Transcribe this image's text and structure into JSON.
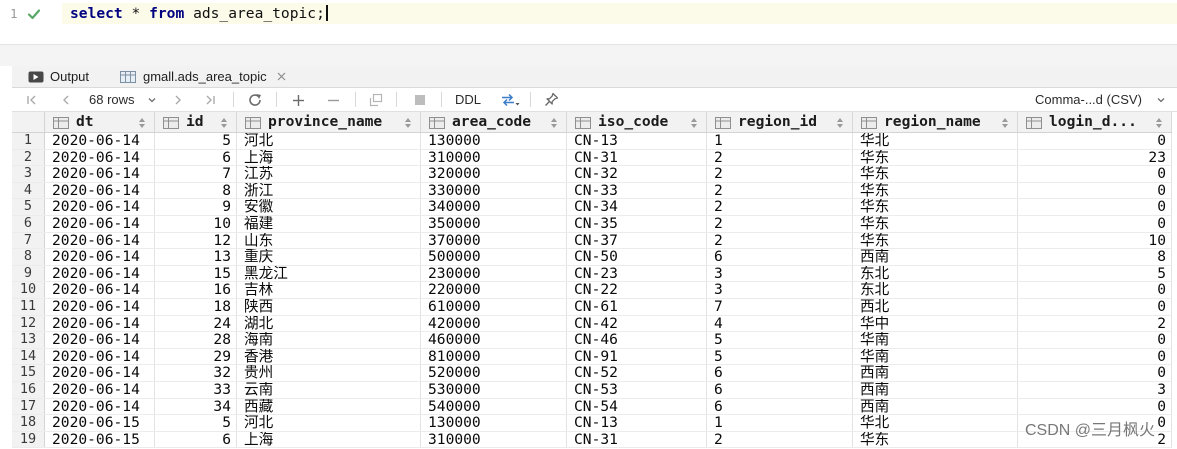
{
  "editor": {
    "line_number": "1",
    "status_icon": "check-icon",
    "tokens": {
      "kw_select": "select",
      "star": "*",
      "kw_from": "from",
      "table": "ads_area_topic",
      "semicolon": ";"
    }
  },
  "tabs": [
    {
      "label": "Output",
      "icon": "console-icon"
    },
    {
      "label": "gmall.ads_area_topic",
      "icon": "table-icon",
      "close_icon": "close-icon"
    }
  ],
  "toolbar": {
    "rows_label": "68 rows",
    "ddl_label": "DDL",
    "export_format": "Comma-...d (CSV)",
    "icons": [
      "first-page-icon",
      "previous-page-icon",
      "chevron-down-icon",
      "next-page-icon",
      "last-page-icon",
      "refresh-icon",
      "add-row-icon",
      "delete-row-icon",
      "revert-icon",
      "stop-icon",
      "transaction-icon",
      "pin-icon"
    ]
  },
  "grid": {
    "columns": [
      "dt",
      "id",
      "province_name",
      "area_code",
      "iso_code",
      "region_id",
      "region_name",
      "login_d..."
    ],
    "rows": [
      {
        "n": "1",
        "cells": [
          "2020-06-14",
          "5",
          "河北",
          "130000",
          "CN-13",
          "1",
          "华北",
          "0"
        ]
      },
      {
        "n": "2",
        "cells": [
          "2020-06-14",
          "6",
          "上海",
          "310000",
          "CN-31",
          "2",
          "华东",
          "23"
        ]
      },
      {
        "n": "3",
        "cells": [
          "2020-06-14",
          "7",
          "江苏",
          "320000",
          "CN-32",
          "2",
          "华东",
          "0"
        ]
      },
      {
        "n": "4",
        "cells": [
          "2020-06-14",
          "8",
          "浙江",
          "330000",
          "CN-33",
          "2",
          "华东",
          "0"
        ]
      },
      {
        "n": "5",
        "cells": [
          "2020-06-14",
          "9",
          "安徽",
          "340000",
          "CN-34",
          "2",
          "华东",
          "0"
        ]
      },
      {
        "n": "6",
        "cells": [
          "2020-06-14",
          "10",
          "福建",
          "350000",
          "CN-35",
          "2",
          "华东",
          "0"
        ]
      },
      {
        "n": "7",
        "cells": [
          "2020-06-14",
          "12",
          "山东",
          "370000",
          "CN-37",
          "2",
          "华东",
          "10"
        ]
      },
      {
        "n": "8",
        "cells": [
          "2020-06-14",
          "13",
          "重庆",
          "500000",
          "CN-50",
          "6",
          "西南",
          "8"
        ]
      },
      {
        "n": "9",
        "cells": [
          "2020-06-14",
          "15",
          "黑龙江",
          "230000",
          "CN-23",
          "3",
          "东北",
          "5"
        ]
      },
      {
        "n": "10",
        "cells": [
          "2020-06-14",
          "16",
          "吉林",
          "220000",
          "CN-22",
          "3",
          "东北",
          "0"
        ]
      },
      {
        "n": "11",
        "cells": [
          "2020-06-14",
          "18",
          "陕西",
          "610000",
          "CN-61",
          "7",
          "西北",
          "0"
        ]
      },
      {
        "n": "12",
        "cells": [
          "2020-06-14",
          "24",
          "湖北",
          "420000",
          "CN-42",
          "4",
          "华中",
          "2"
        ]
      },
      {
        "n": "13",
        "cells": [
          "2020-06-14",
          "28",
          "海南",
          "460000",
          "CN-46",
          "5",
          "华南",
          "0"
        ]
      },
      {
        "n": "14",
        "cells": [
          "2020-06-14",
          "29",
          "香港",
          "810000",
          "CN-91",
          "5",
          "华南",
          "0"
        ]
      },
      {
        "n": "15",
        "cells": [
          "2020-06-14",
          "32",
          "贵州",
          "520000",
          "CN-52",
          "6",
          "西南",
          "0"
        ]
      },
      {
        "n": "16",
        "cells": [
          "2020-06-14",
          "33",
          "云南",
          "530000",
          "CN-53",
          "6",
          "西南",
          "3"
        ]
      },
      {
        "n": "17",
        "cells": [
          "2020-06-14",
          "34",
          "西藏",
          "540000",
          "CN-54",
          "6",
          "西南",
          "0"
        ]
      },
      {
        "n": "18",
        "cells": [
          "2020-06-15",
          "5",
          "河北",
          "130000",
          "CN-13",
          "1",
          "华北",
          "0"
        ]
      },
      {
        "n": "19",
        "cells": [
          "2020-06-15",
          "6",
          "上海",
          "310000",
          "CN-31",
          "2",
          "华东",
          "2"
        ]
      }
    ]
  },
  "watermark": "CSDN @三月枫火",
  "colors": {
    "keyword": "#000080",
    "check": "#59a869",
    "current_line": "#fcfae8",
    "header_bg": "#f2f2f2",
    "transaction_icon": "#3d7ec9"
  }
}
